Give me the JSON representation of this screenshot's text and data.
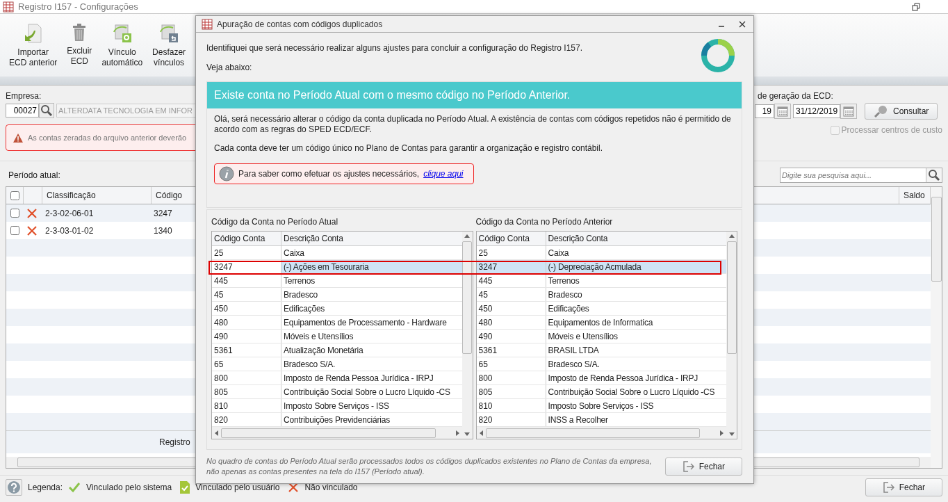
{
  "window": {
    "title": "Registro I157 - Configurações"
  },
  "toolbar": [
    {
      "kind": "import",
      "label": "Importar\nECD anterior"
    },
    {
      "kind": "delete",
      "label": "Excluir\nECD"
    },
    {
      "kind": "auto_link",
      "label": "Vínculo\nautomático"
    },
    {
      "kind": "undo_link",
      "label": "Desfazer\nvínculos"
    }
  ],
  "filters": {
    "company_label": "Empresa:",
    "company_code": "00027",
    "company_name": "ALTERDATA TECNOLOGIA EM INFOR",
    "date_label": "de geração da ECD:",
    "start_date": "19",
    "end_date": "31/12/2019",
    "search_button": "Consultar",
    "cost_centers": {
      "label": "Processar centros de custo",
      "checked": false,
      "disabled": true
    }
  },
  "warning": "As contas zeradas do arquivo anterior deverão",
  "current_period": {
    "label": "Período atual:",
    "search_placeholder": "Digite sua pesquisa aqui...",
    "columns": [
      "Classificação",
      "Código",
      "Saldo"
    ],
    "all_checked": false,
    "rows": [
      {
        "checked": false,
        "kind": "unlinked",
        "classification": "2-3-02-06-01",
        "code": "3247"
      },
      {
        "checked": false,
        "kind": "unlinked",
        "classification": "2-3-03-01-02",
        "code": "1340"
      }
    ],
    "footer_label": "Registro"
  },
  "legend": {
    "label": "Legenda:",
    "items": [
      {
        "kind": "system",
        "label": "Vinculado pelo sistema"
      },
      {
        "kind": "user",
        "label": "Vinculado pelo usuário"
      },
      {
        "kind": "unlinked",
        "label": "Não vinculado"
      }
    ]
  },
  "close_button": "Fechar",
  "dialog": {
    "title": "Apuração de contas com códigos duplicados",
    "intro": "Identifiquei que será necessário realizar alguns ajustes para concluir a configuração do Registro I157.",
    "see_below": "Veja abaixo:",
    "card_title": "Existe conta no Período Atual com o mesmo código no Período Anterior.",
    "paragraphs": [
      "Olá, será necessário alterar o código da conta duplicada no Período Atual. A existência de contas com códigos repetidos não é permitido de acordo com as regras do SPED ECD/ECF.",
      "Cada conta deve ter um código único no Plano de Contas para garantir a organização e registro contábil."
    ],
    "info": {
      "text": "Para saber como efetuar os ajustes necessários,",
      "link": "clique aqui"
    },
    "grids": [
      {
        "label": "Código da Conta no Período Atual",
        "columns": [
          "Código Conta",
          "Descrição Conta"
        ],
        "rows": [
          {
            "code": "25",
            "description": "Caixa",
            "selected": false
          },
          {
            "code": "3247",
            "description": "(-) Ações em Tesouraria",
            "selected": true
          },
          {
            "code": "445",
            "description": "Terrenos",
            "selected": false
          },
          {
            "code": "45",
            "description": "Bradesco",
            "selected": false
          },
          {
            "code": "450",
            "description": "Edificações",
            "selected": false
          },
          {
            "code": "480",
            "description": "Equipamentos de Processamento - Hardware",
            "selected": false
          },
          {
            "code": "490",
            "description": "Móveis e Utensílios",
            "selected": false
          },
          {
            "code": "5361",
            "description": "Atualização Monetária",
            "selected": false
          },
          {
            "code": "65",
            "description": "Bradesco S/A.",
            "selected": false
          },
          {
            "code": "800",
            "description": "Imposto de Renda Pessoa Jurídica - IRPJ",
            "selected": false
          },
          {
            "code": "805",
            "description": "Contribuição Social  Sobre o Lucro Líquido -CS",
            "selected": false
          },
          {
            "code": "810",
            "description": "Imposto Sobre Serviços - ISS",
            "selected": false
          },
          {
            "code": "820",
            "description": "Contribuições Previdenciárias",
            "selected": false
          }
        ]
      },
      {
        "label": "Código da Conta no Período Anterior",
        "columns": [
          "Código Conta",
          "Descrição Conta"
        ],
        "rows": [
          {
            "code": "25",
            "description": "Caixa",
            "selected": false
          },
          {
            "code": "3247",
            "description": "(-) Depreciação Acmulada",
            "selected": true
          },
          {
            "code": "445",
            "description": "Terrenos",
            "selected": false
          },
          {
            "code": "45",
            "description": "Bradesco",
            "selected": false
          },
          {
            "code": "450",
            "description": "Edificações",
            "selected": false
          },
          {
            "code": "480",
            "description": "Equipamentos de Informatica",
            "selected": false
          },
          {
            "code": "490",
            "description": "Móveis e Utensílios",
            "selected": false
          },
          {
            "code": "5361",
            "description": "BRASIL LTDA",
            "selected": false
          },
          {
            "code": "65",
            "description": "Bradesco S/A.",
            "selected": false
          },
          {
            "code": "800",
            "description": "Imposto de Renda Pessoa Jurídica - IRPJ",
            "selected": false
          },
          {
            "code": "805",
            "description": "Contribuição Social  Sobre o Lucro Líquido -CS",
            "selected": false
          },
          {
            "code": "810",
            "description": "Imposto Sobre Serviços - ISS",
            "selected": false
          },
          {
            "code": "820",
            "description": "INSS a Recolher",
            "selected": false
          }
        ]
      }
    ],
    "note": "No quadro de contas do Período Atual serão processados todos os códigos duplicados existentes no Plano de Contas da empresa,\nnão apenas as contas presentes na tela do I157 (Período atual).",
    "close_button": "Fechar"
  }
}
